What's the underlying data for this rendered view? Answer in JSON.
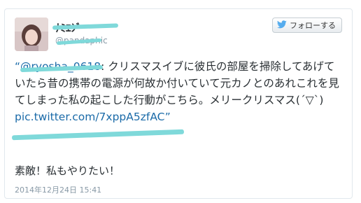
{
  "tweet": {
    "display_name": "ﾅﾐｴｼﾞ",
    "handle": "@pandaphic",
    "follow_label": "フォローする",
    "mention": "“@ryosha_0618",
    "body": ": クリスマスイブに彼氏の部屋を掃除してあげていたら昔の携帯の電源が何故か付いていて元カノとのあれこれを見てしまった私の起こした行動がこちら。メリークリスマス(´▽`)",
    "link": "pic.twitter.com/7xppA5zfAC”",
    "reply": "素敵！私もやりたい！",
    "timestamp": "2014年12月24日 15:41"
  },
  "colors": {
    "link": "#1a6aa8",
    "scribble": "#7fd9da",
    "twitter_bird": "#55acee",
    "muted": "#8899a6"
  },
  "icons": {
    "follow": "twitter-bird-icon",
    "avatar": "user-avatar"
  }
}
